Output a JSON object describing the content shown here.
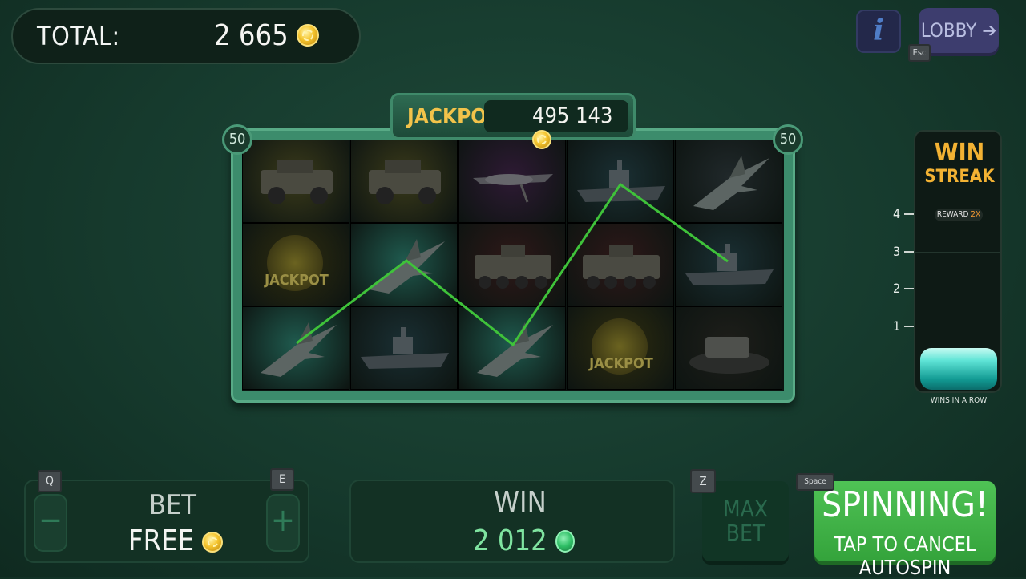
{
  "header": {
    "total_label": "TOTAL:",
    "total_value": "2 665",
    "info_label": "i",
    "lobby_label": "LOBBY ➔",
    "esc_key": "Esc"
  },
  "jackpot": {
    "label": "JACKPOT",
    "value": "495 143"
  },
  "reels": {
    "lines_left": "50",
    "lines_right": "50",
    "symbols": [
      [
        "humvee",
        "humvee",
        "drone",
        "battleship",
        "fighter-jet"
      ],
      [
        "jackpot",
        "fighter-jet",
        "apc",
        "apc",
        "battleship"
      ],
      [
        "fighter-jet",
        "battleship",
        "fighter-jet",
        "jackpot",
        "hovercraft"
      ]
    ],
    "jackpot_symbol_text": "JACKPOT",
    "win_line_color": "#3fc23a"
  },
  "win_streak": {
    "title_line1": "WIN",
    "title_line2": "STREAK",
    "reward_label": "REWARD",
    "reward_value": "2X",
    "ticks": [
      "4",
      "3",
      "2",
      "1"
    ],
    "caption": "WINS IN A ROW"
  },
  "controls": {
    "bet_label": "BET",
    "bet_value": "FREE",
    "bet_minus_key": "Q",
    "bet_plus_key": "E",
    "win_label": "WIN",
    "win_value": "2 012",
    "max_bet_line1": "MAX",
    "max_bet_line2": "BET",
    "max_bet_key": "Z",
    "spin_title": "SPINNING!",
    "spin_subtitle": "TAP TO CANCEL AUTOSPIN",
    "spin_key": "Space"
  }
}
